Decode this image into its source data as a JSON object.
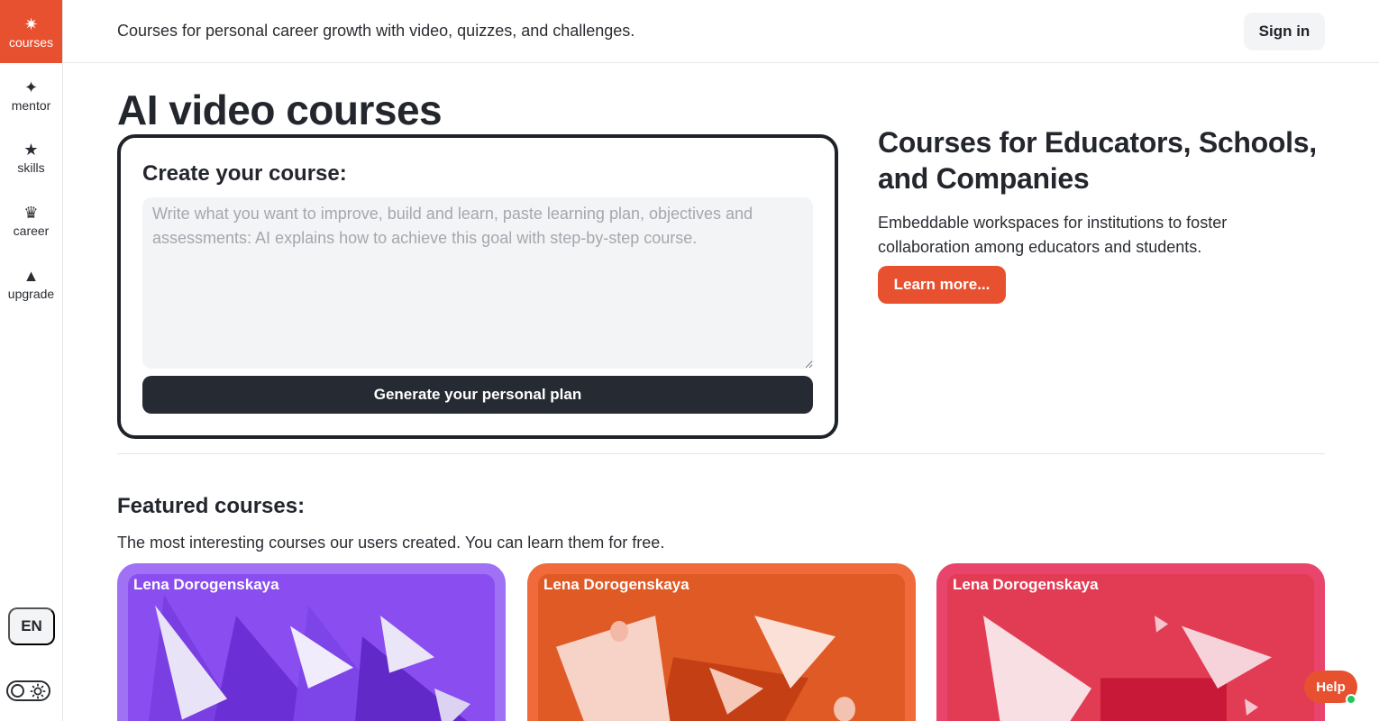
{
  "sidebar": {
    "items": [
      {
        "label": "courses",
        "icon": "starburst-icon",
        "glyph": "✷",
        "active": true
      },
      {
        "label": "mentor",
        "icon": "sparkle-icon",
        "glyph": "✦",
        "active": false
      },
      {
        "label": "skills",
        "icon": "star-icon",
        "glyph": "★",
        "active": false
      },
      {
        "label": "career",
        "icon": "crown-icon",
        "glyph": "♛",
        "active": false
      },
      {
        "label": "upgrade",
        "icon": "triangle-up-icon",
        "glyph": "▲",
        "active": false
      }
    ],
    "language": "EN"
  },
  "header": {
    "tagline": "Courses for personal career growth with video, quizzes, and challenges.",
    "signin_label": "Sign in"
  },
  "main": {
    "title": "AI video courses",
    "create": {
      "title": "Create your course:",
      "placeholder": "Write what you want to improve, build and learn, paste learning plan, objectives and assessments: AI explains how to achieve this goal with step-by-step course.",
      "value": "",
      "button_label": "Generate your personal plan"
    },
    "educators": {
      "title": "Courses for Educators, Schools, and Companies",
      "description": "Embeddable workspaces for institutions to foster collaboration among educators and students.",
      "button_label": "Learn more..."
    },
    "featured": {
      "title": "Featured courses:",
      "subtitle": "The most interesting courses our users created. You can learn them for free.",
      "courses": [
        {
          "author": "Lena Dorogenskaya"
        },
        {
          "author": "Lena Dorogenskaya"
        },
        {
          "author": "Lena Dorogenskaya"
        }
      ]
    }
  },
  "help": {
    "label": "Help"
  },
  "colors": {
    "accent": "#e8512f",
    "dark": "#252a33",
    "card_purple": "#a071f5",
    "card_orange": "#f06a3c",
    "card_pink": "#e9456c"
  }
}
